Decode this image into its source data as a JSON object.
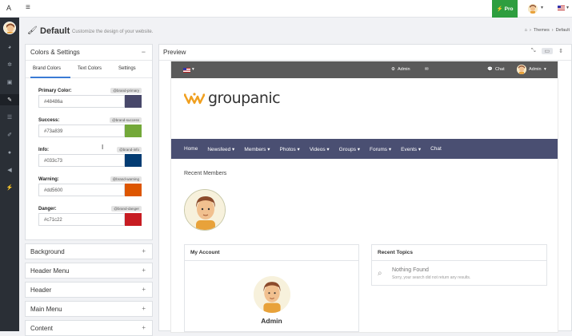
{
  "topbar": {
    "logo": "A",
    "pro_label": "Pro"
  },
  "page": {
    "title": "Default",
    "subtitle": "Customize the design of your website.",
    "breadcrumb": [
      "Themes",
      "Default"
    ]
  },
  "settings": {
    "title": "Colors & Settings",
    "tabs": [
      "Brand Colors",
      "Text Colors",
      "Settings"
    ],
    "colors": [
      {
        "label": "Primary Color:",
        "badge": "@brand-primary",
        "value": "#48486a",
        "color": "#48486a"
      },
      {
        "label": "Success:",
        "badge": "@brand-success",
        "value": "#73a839",
        "color": "#73a839"
      },
      {
        "label": "Info:",
        "badge": "@brand-info",
        "value": "#033c73",
        "color": "#033c73"
      },
      {
        "label": "Warning:",
        "badge": "@brand-warning",
        "value": "#dd5600",
        "color": "#dd5600"
      },
      {
        "label": "Danger:",
        "badge": "@brand-danger",
        "value": "#c71c22",
        "color": "#c71c22"
      }
    ],
    "sections": [
      "Background",
      "Header Menu",
      "Header",
      "Main Menu",
      "Content"
    ]
  },
  "preview": {
    "title": "Preview",
    "site": {
      "top_admin": "Admin",
      "top_chat": "Chat",
      "top_user": "Admin",
      "logo": "groupanic",
      "nav": [
        "Home",
        "Newsfeed ▾",
        "Members ▾",
        "Photos ▾",
        "Videos ▾",
        "Groups ▾",
        "Forums ▾",
        "Events ▾",
        "Chat"
      ],
      "recent_members": "Recent Members",
      "my_account": "My Account",
      "account_name": "Admin",
      "recent_topics": "Recent Topics",
      "nothing_found": "Nothing Found",
      "nothing_sub": "Sorry, your search did not return any results."
    }
  }
}
